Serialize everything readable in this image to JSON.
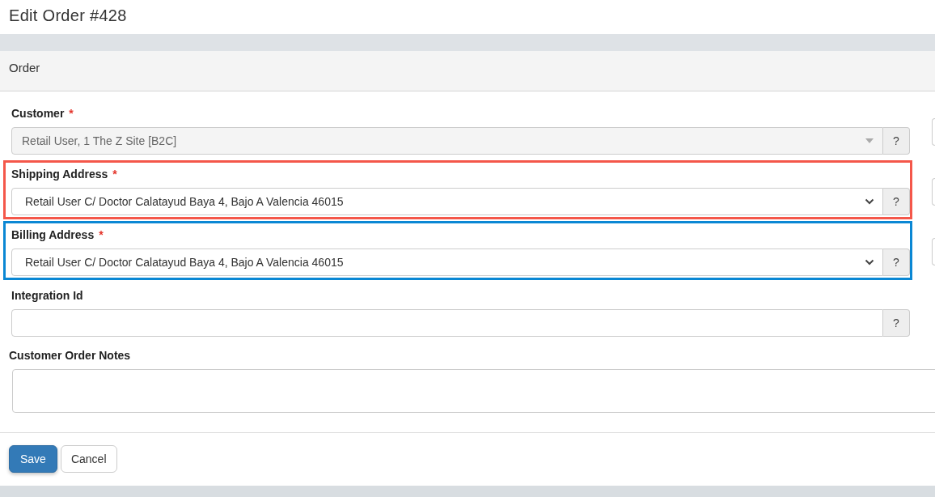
{
  "page_title": "Edit Order #428",
  "card_header": "Order",
  "fields": [
    {
      "kind": "select",
      "label": "Customer",
      "required_mark": "*",
      "value": "Retail User, 1 The Z Site [B2C]",
      "disabled": true,
      "help": "?"
    },
    {
      "kind": "select",
      "label": "Shipping Address",
      "required_mark": "*",
      "value": "Retail User C/ Doctor Calatayud Baya 4, Bajo A Valencia 46015",
      "disabled": false,
      "help": "?",
      "color": "#f4574a"
    },
    {
      "kind": "select",
      "label": "Billing Address",
      "required_mark": "*",
      "value": "Retail User C/ Doctor Calatayud Baya 4, Bajo A Valencia 46015",
      "disabled": false,
      "help": "?",
      "color": "#0a87d4"
    },
    {
      "kind": "input",
      "label": "Integration Id",
      "disabled": false,
      "help": "?"
    },
    {
      "kind": "textarea",
      "label": "Customer Order Notes",
      "disabled": false
    }
  ],
  "buttons": [
    {
      "label": "Save",
      "kind": "primary"
    },
    {
      "label": "Cancel",
      "kind": "secondary"
    }
  ]
}
